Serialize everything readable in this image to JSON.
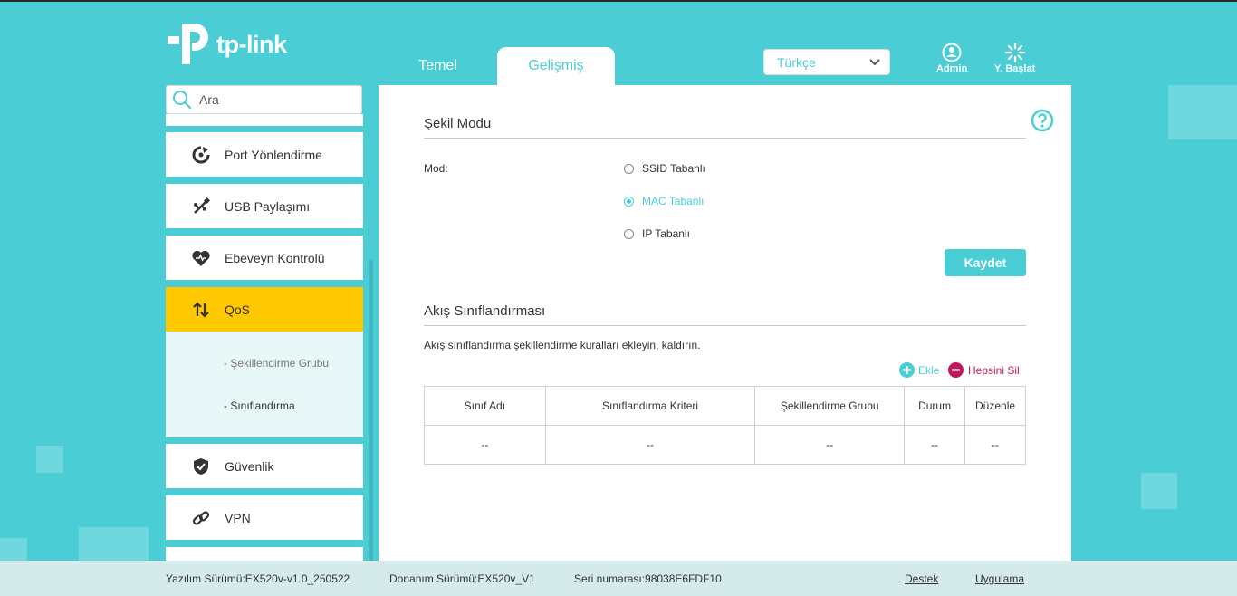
{
  "brand": {
    "logo_text": "tp-link"
  },
  "tabs": [
    {
      "label": "Temel",
      "active": false
    },
    {
      "label": "Gelişmiş",
      "active": true
    }
  ],
  "language": {
    "selected": "Türkçe"
  },
  "header_buttons": {
    "admin": "Admin",
    "reboot": "Y. Başlat"
  },
  "search": {
    "placeholder": "Ara"
  },
  "sidebar": {
    "items": [
      {
        "label": "Port Yönlendirme",
        "icon": "port-forwarding-icon"
      },
      {
        "label": "USB Paylaşımı",
        "icon": "usb-icon"
      },
      {
        "label": "Ebeveyn Kontrolü",
        "icon": "heart-icon"
      },
      {
        "label": "QoS",
        "icon": "qos-arrows-icon",
        "active": true
      },
      {
        "label": "Güvenlik",
        "icon": "shield-icon"
      },
      {
        "label": "VPN",
        "icon": "link-icon"
      }
    ],
    "qos_sub": [
      "- Şekillendirme Grubu",
      "- Sınıflandırma"
    ]
  },
  "main": {
    "shape_mode": {
      "title": "Şekil Modu",
      "mode_label": "Mod:",
      "options": [
        {
          "label": "SSID Tabanlı",
          "selected": false
        },
        {
          "label": "MAC Tabanlı",
          "selected": true
        },
        {
          "label": "IP Tabanlı",
          "selected": false
        }
      ],
      "save_label": "Kaydet"
    },
    "classification": {
      "title": "Akış Sınıflandırması",
      "description": "Akış sınıflandırma şekillendirme kuralları ekleyin, kaldırın.",
      "add_label": "Ekle",
      "delete_all_label": "Hepsini Sil",
      "columns": [
        "Sınıf Adı",
        "Sınıflandırma Kriteri",
        "Şekillendirme Grubu",
        "Durum",
        "Düzenle"
      ],
      "rows": [
        [
          "--",
          "--",
          "--",
          "--",
          "--"
        ]
      ]
    }
  },
  "footer": {
    "firmware": "Yazılım Sürümü:EX520v-v1.0_250522",
    "hardware": "Donanım Sürümü:EX520v_V1",
    "serial": "Seri numarası:98038E6FDF10",
    "support": "Destek",
    "app": "Uygulama"
  },
  "colors": {
    "accent": "#4bcdd6",
    "active_nav": "#ffc800",
    "delete": "#c2185b"
  }
}
